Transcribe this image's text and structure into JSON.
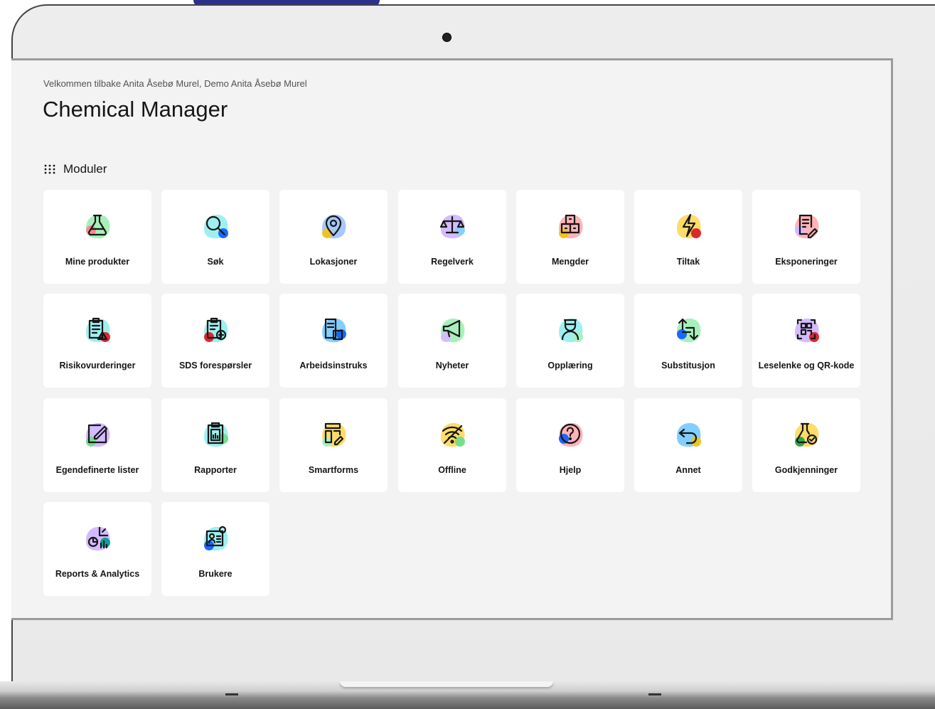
{
  "header": {
    "welcome": "Velkommen tilbake Anita Åsebø Murel, Demo Anita Åsebø Murel",
    "title": "Chemical Manager"
  },
  "modules": {
    "heading": "Moduler",
    "icon": "grid-dots-icon",
    "items": [
      {
        "label": "Mine produkter",
        "icon": "flask-icon",
        "accent": "#a7f0ba",
        "accent2": "#ff8389"
      },
      {
        "label": "Søk",
        "icon": "magnifier-icon",
        "accent": "#9ef0f0",
        "accent2": "#0f62fe"
      },
      {
        "label": "Lokasjoner",
        "icon": "location-pin-icon",
        "accent": "#a6c8ff",
        "accent2": "#f1c21b"
      },
      {
        "label": "Regelverk",
        "icon": "scale-icon",
        "accent": "#d4bbff",
        "accent2": "#82cfff"
      },
      {
        "label": "Mengder",
        "icon": "boxes-icon",
        "accent": "#ffb3b8",
        "accent2": "#f1c21b"
      },
      {
        "label": "Tiltak",
        "icon": "lightning-icon",
        "accent": "#fddc69",
        "accent2": "#da1e28"
      },
      {
        "label": "Eksponeringer",
        "icon": "document-pencil-icon",
        "accent": "#ffb3b8",
        "accent2": "#d4bbff"
      },
      {
        "label": "Risikovurderinger",
        "icon": "clipboard-warning-icon",
        "accent": "#9ef0f0",
        "accent2": "#da1e28"
      },
      {
        "label": "SDS forespørsler",
        "icon": "clipboard-add-icon",
        "accent": "#9ef0f0",
        "accent2": "#da1e28"
      },
      {
        "label": "Arbeidsinstruks",
        "icon": "document-factory-icon",
        "accent": "#82cfff",
        "accent2": "#0f62fe"
      },
      {
        "label": "Nyheter",
        "icon": "megaphone-icon",
        "accent": "#a7f0ba",
        "accent2": "#d4bbff"
      },
      {
        "label": "Opplæring",
        "icon": "graduate-icon",
        "accent": "#9ef0f0",
        "accent2": "#a7f0ba"
      },
      {
        "label": "Substitusjon",
        "icon": "swap-arrows-icon",
        "accent": "#a7f0ba",
        "accent2": "#0f62fe"
      },
      {
        "label": "Leselenke og QR-kode",
        "icon": "qr-code-icon",
        "accent": "#d4bbff",
        "accent2": "#da1e28"
      },
      {
        "label": "Egendefinerte lister",
        "icon": "edit-square-icon",
        "accent": "#d4bbff",
        "accent2": "#6fdc8c"
      },
      {
        "label": "Rapporter",
        "icon": "clipboard-chart-icon",
        "accent": "#9ef0f0",
        "accent2": "#6fdc8c"
      },
      {
        "label": "Smartforms",
        "icon": "form-pencil-icon",
        "accent": "#fddc69",
        "accent2": "#a7f0ba"
      },
      {
        "label": "Offline",
        "icon": "wifi-off-icon",
        "accent": "#fddc69",
        "accent2": "#6fdc8c"
      },
      {
        "label": "Hjelp",
        "icon": "help-circle-icon",
        "accent": "#ffb3b8",
        "accent2": "#0f62fe"
      },
      {
        "label": "Annet",
        "icon": "undo-arrow-icon",
        "accent": "#82cfff",
        "accent2": "#f1c21b"
      },
      {
        "label": "Godkjenninger",
        "icon": "flask-check-icon",
        "accent": "#fddc69",
        "accent2": "#24a148"
      },
      {
        "label": "Reports & Analytics",
        "icon": "analytics-icon",
        "accent": "#d4bbff",
        "accent2": "#009d9a"
      },
      {
        "label": "Brukere",
        "icon": "user-card-icon",
        "accent": "#9ef0f0",
        "accent2": "#0f62fe"
      }
    ]
  }
}
